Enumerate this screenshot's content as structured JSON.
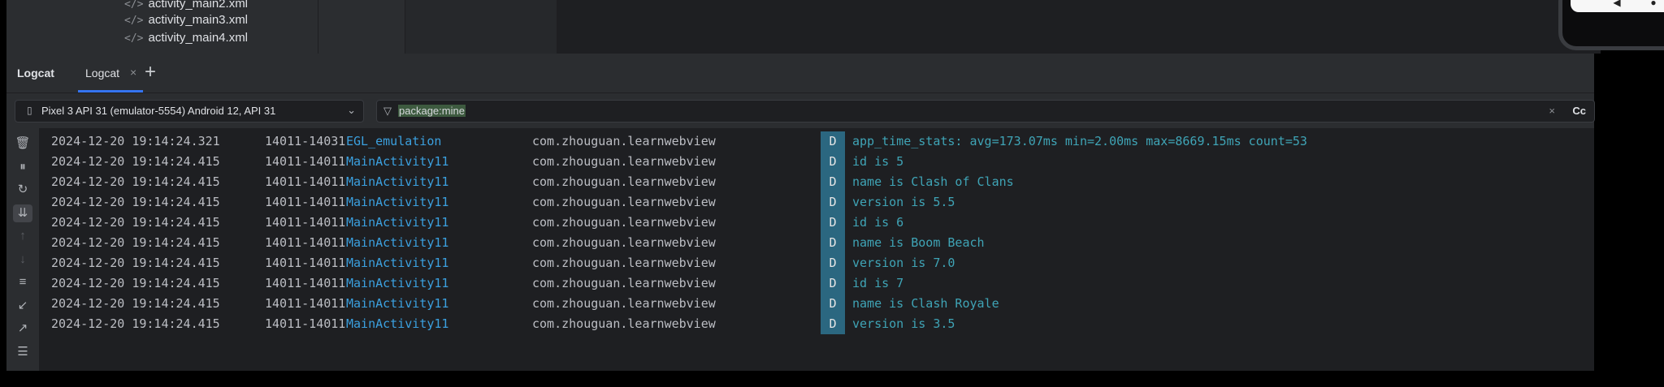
{
  "project_tree": {
    "items": [
      {
        "icon": "xml-file-icon",
        "glyph": "</>",
        "label": "activity_main2.xml"
      },
      {
        "icon": "xml-file-icon",
        "glyph": "</>",
        "label": "activity_main3.xml"
      },
      {
        "icon": "xml-file-icon",
        "glyph": "</>",
        "label": "activity_main4.xml"
      }
    ]
  },
  "emulator": {
    "back": "◀",
    "home": "●",
    "recents": "■"
  },
  "logcat": {
    "title": "Logcat",
    "tab_label": "Logcat",
    "tab_close": "×",
    "add_tab": "+",
    "device_selector": {
      "icon": "device-icon",
      "glyph": "▯",
      "value": "Pixel 3 API 31 (emulator-5554) Android 12, API 31",
      "chevron": "⌄"
    },
    "filter": {
      "icon": "filter-icon",
      "glyph": "▽",
      "value": "package:mine",
      "clear": "×",
      "case_toggle": "Cc"
    },
    "toolbar": [
      {
        "name": "clear-logcat-icon",
        "glyph": "🗑︎",
        "dim": false,
        "active": false
      },
      {
        "name": "pause-icon",
        "glyph": "⏸︎",
        "dim": false,
        "active": false
      },
      {
        "name": "restart-icon",
        "glyph": "↻",
        "dim": false,
        "active": false
      },
      {
        "name": "scroll-to-end-icon",
        "glyph": "⇊",
        "dim": false,
        "active": true
      },
      {
        "name": "up-arrow-icon",
        "glyph": "↑",
        "dim": true,
        "active": false
      },
      {
        "name": "down-arrow-icon",
        "glyph": "↓",
        "dim": true,
        "active": false
      },
      {
        "name": "soft-wrap-icon",
        "glyph": "≡",
        "dim": false,
        "active": false
      },
      {
        "name": "import-icon",
        "glyph": "↙",
        "dim": false,
        "active": false
      },
      {
        "name": "export-icon",
        "glyph": "↗",
        "dim": false,
        "active": false
      },
      {
        "name": "settings-icon",
        "glyph": "☰",
        "dim": false,
        "active": false
      }
    ],
    "rows": [
      {
        "ts": "2024-12-20 19:14:24.321",
        "pid": "14011-14031",
        "tag": "EGL_emulation",
        "pkg": "com.zhouguan.learnwebview",
        "level": "D",
        "msg": "app_time_stats: avg=173.07ms min=2.00ms max=8669.15ms count=53"
      },
      {
        "ts": "2024-12-20 19:14:24.415",
        "pid": "14011-14011",
        "tag": "MainActivity11",
        "pkg": "com.zhouguan.learnwebview",
        "level": "D",
        "msg": "id is 5"
      },
      {
        "ts": "2024-12-20 19:14:24.415",
        "pid": "14011-14011",
        "tag": "MainActivity11",
        "pkg": "com.zhouguan.learnwebview",
        "level": "D",
        "msg": "name is Clash of Clans"
      },
      {
        "ts": "2024-12-20 19:14:24.415",
        "pid": "14011-14011",
        "tag": "MainActivity11",
        "pkg": "com.zhouguan.learnwebview",
        "level": "D",
        "msg": "version is 5.5"
      },
      {
        "ts": "2024-12-20 19:14:24.415",
        "pid": "14011-14011",
        "tag": "MainActivity11",
        "pkg": "com.zhouguan.learnwebview",
        "level": "D",
        "msg": "id is 6"
      },
      {
        "ts": "2024-12-20 19:14:24.415",
        "pid": "14011-14011",
        "tag": "MainActivity11",
        "pkg": "com.zhouguan.learnwebview",
        "level": "D",
        "msg": "name is Boom Beach"
      },
      {
        "ts": "2024-12-20 19:14:24.415",
        "pid": "14011-14011",
        "tag": "MainActivity11",
        "pkg": "com.zhouguan.learnwebview",
        "level": "D",
        "msg": "version is 7.0"
      },
      {
        "ts": "2024-12-20 19:14:24.415",
        "pid": "14011-14011",
        "tag": "MainActivity11",
        "pkg": "com.zhouguan.learnwebview",
        "level": "D",
        "msg": "id is 7"
      },
      {
        "ts": "2024-12-20 19:14:24.415",
        "pid": "14011-14011",
        "tag": "MainActivity11",
        "pkg": "com.zhouguan.learnwebview",
        "level": "D",
        "msg": "name is Clash Royale"
      },
      {
        "ts": "2024-12-20 19:14:24.415",
        "pid": "14011-14011",
        "tag": "MainActivity11",
        "pkg": "com.zhouguan.learnwebview",
        "level": "D",
        "msg": "version is 3.5"
      }
    ]
  },
  "colors": {
    "tag": "#3ba0df",
    "message": "#3fa4b6",
    "level_badge": "#2b6780",
    "accent": "#3574f0"
  }
}
